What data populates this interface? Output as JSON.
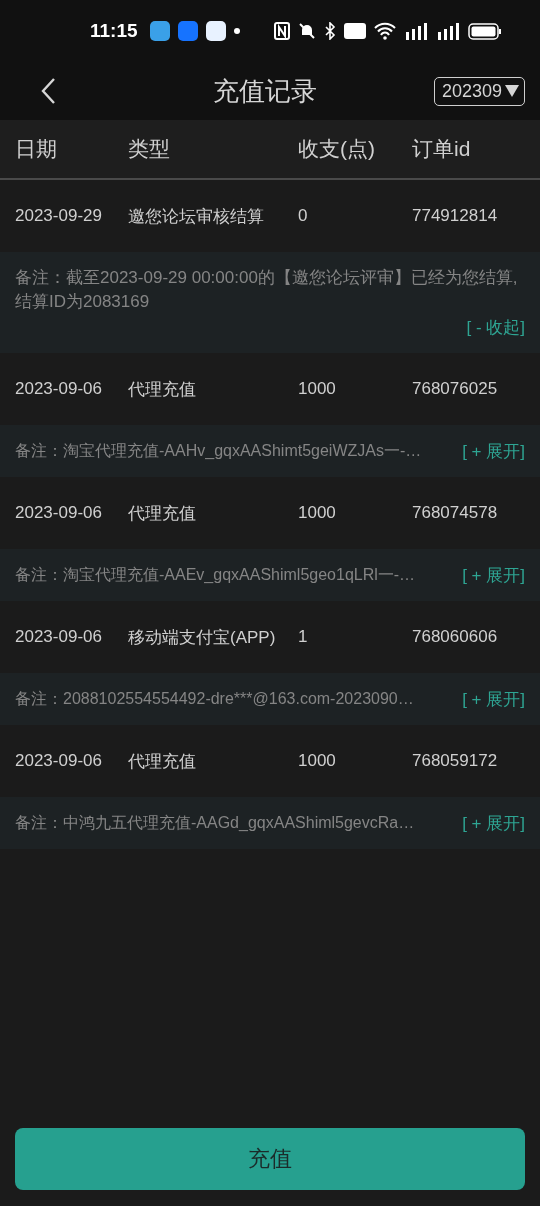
{
  "status_bar": {
    "time": "11:15"
  },
  "header": {
    "title": "充值记录",
    "month": "202309"
  },
  "table": {
    "columns": [
      "日期",
      "类型",
      "收支(点)",
      "订单id"
    ],
    "records": [
      {
        "cells": [
          "2023-09-29",
          "邀您论坛审核结算",
          "0",
          "774912814"
        ],
        "note": {
          "text": "备注：截至2023-09-29 00:00:00的【邀您论坛评审】已经为您结算,结算ID为2083169",
          "toggle": "[ - 收起]",
          "expanded": true
        }
      },
      {
        "cells": [
          "2023-09-06",
          "代理充值",
          "1000",
          "768076025"
        ],
        "note": {
          "text": "备注：淘宝代理充值-AAHv_gqxAAShimt5geiWZJAs一-…",
          "toggle": "[ + 展开]",
          "expanded": false
        }
      },
      {
        "cells": [
          "2023-09-06",
          "代理充值",
          "1000",
          "768074578"
        ],
        "note": {
          "text": "备注：淘宝代理充值-AAEv_gqxAAShiml5geo1qLRl一-…",
          "toggle": "[ + 展开]",
          "expanded": false
        }
      },
      {
        "cells": [
          "2023-09-06",
          "移动端支付宝(APP)",
          "1",
          "768060606"
        ],
        "note": {
          "text": "备注：2088102554554492-dre***@163.com-2023090…",
          "toggle": "[ + 展开]",
          "expanded": false
        }
      },
      {
        "cells": [
          "2023-09-06",
          "代理充值",
          "1000",
          "768059172"
        ],
        "note": {
          "text": "备注：中鸿九五代理充值-AAGd_gqxAAShiml5gevcRa…",
          "toggle": "[ + 展开]",
          "expanded": false
        }
      }
    ]
  },
  "recharge_button": "充值"
}
